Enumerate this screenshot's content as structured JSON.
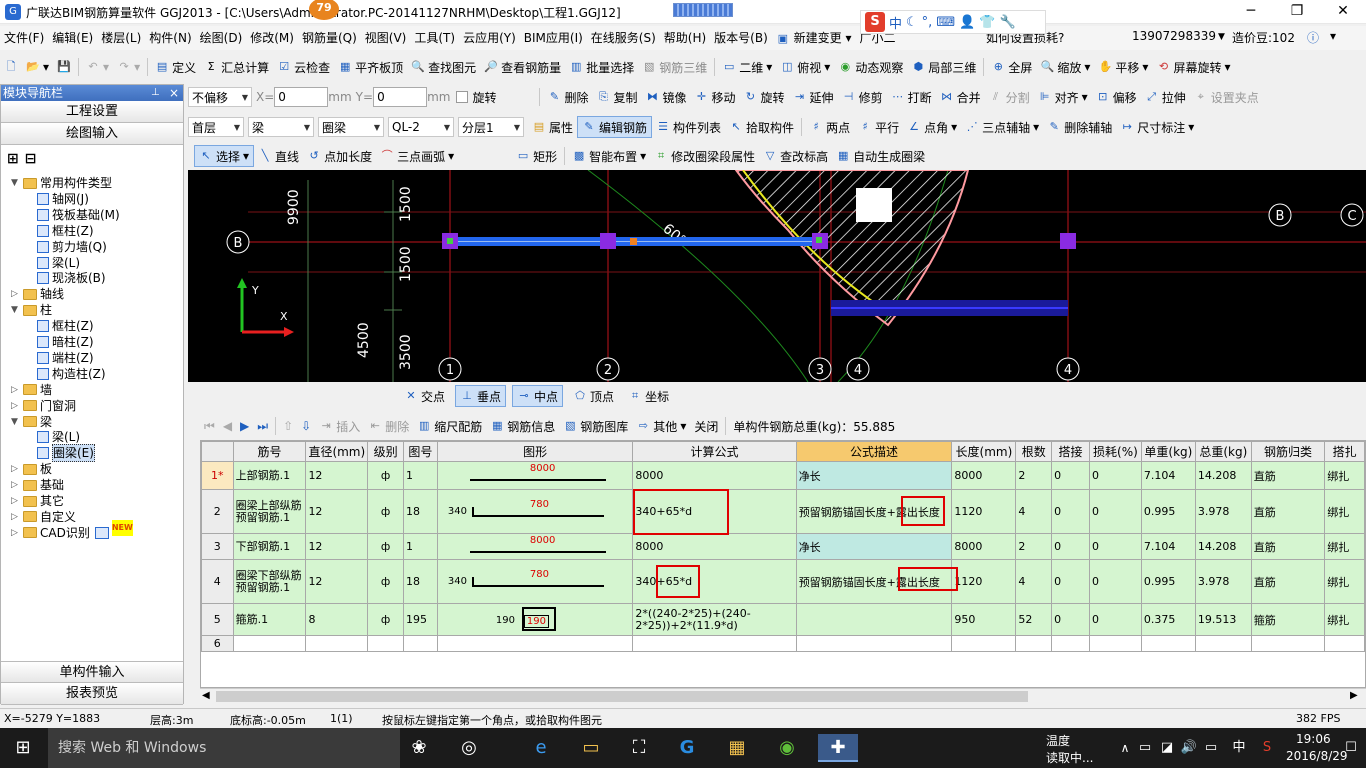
{
  "titlebar": {
    "title": "广联达BIM钢筋算量软件 GGJ2013 - [C:\\Users\\Administrator.PC-20141127NRHM\\Desktop\\工程1.GGJ12]",
    "badge": "79",
    "minimize": "─",
    "restore": "❐",
    "close": "✕"
  },
  "ime": {
    "logo": "S",
    "mode": "中"
  },
  "menubar": {
    "items": [
      "文件(F)",
      "编辑(E)",
      "楼层(L)",
      "构件(N)",
      "绘图(D)",
      "修改(M)",
      "钢筋量(Q)",
      "视图(V)",
      "工具(T)",
      "云应用(Y)",
      "BIM应用(I)",
      "在线服务(S)",
      "帮助(H)",
      "版本号(B)"
    ],
    "new_change": "新建变更",
    "guangxiaoer": "广小二",
    "question": "如何设置损耗?",
    "phone": "13907298339",
    "credits": "造价豆:102"
  },
  "toolbar1": {
    "items": [
      "定义",
      "汇总计算",
      "云检查",
      "平齐板顶",
      "查找图元",
      "查看钢筋量",
      "批量选择",
      "钢筋三维"
    ],
    "view_items": [
      "二维",
      "俯视",
      "动态观察",
      "局部三维",
      "全屏",
      "缩放",
      "平移",
      "屏幕旋转"
    ]
  },
  "toolbar2": {
    "offset_mode": "不偏移",
    "x_label": "X=",
    "x_value": "0",
    "unit_mm": "mm",
    "y_label": "Y=",
    "y_value": "0",
    "rotate": "旋转",
    "items": [
      "删除",
      "复制",
      "镜像",
      "移动",
      "旋转",
      "延伸",
      "修剪",
      "打断",
      "合并",
      "分割",
      "对齐",
      "偏移",
      "拉伸",
      "设置夹点"
    ]
  },
  "toolbar3": {
    "floor": "首层",
    "type": "梁",
    "subtype": "圈梁",
    "name": "QL-2",
    "layer": "分层1",
    "items": [
      "属性",
      "编辑钢筋",
      "构件列表",
      "拾取构件",
      "两点",
      "平行",
      "点角",
      "三点辅轴",
      "删除辅轴",
      "尺寸标注"
    ]
  },
  "toolbar4": {
    "items": [
      "选择",
      "直线",
      "点加长度",
      "三点画弧",
      "矩形",
      "智能布置",
      "修改圈梁段属性",
      "查改标高",
      "自动生成圈梁"
    ]
  },
  "leftpanel": {
    "title": "模块导航栏",
    "pin": "📌",
    "close": "×",
    "tabs": [
      "工程设置",
      "绘图输入"
    ],
    "bottom_tabs": [
      "单构件输入",
      "报表预览"
    ],
    "tree": [
      {
        "label": "常用构件类型",
        "level": 1,
        "kind": "folder",
        "expanded": true
      },
      {
        "label": "轴网(J)",
        "level": 2,
        "kind": "leaf"
      },
      {
        "label": "筏板基础(M)",
        "level": 2,
        "kind": "leaf"
      },
      {
        "label": "框柱(Z)",
        "level": 2,
        "kind": "leaf"
      },
      {
        "label": "剪力墙(Q)",
        "level": 2,
        "kind": "leaf"
      },
      {
        "label": "梁(L)",
        "level": 2,
        "kind": "leaf"
      },
      {
        "label": "现浇板(B)",
        "level": 2,
        "kind": "leaf"
      },
      {
        "label": "轴线",
        "level": 1,
        "kind": "folder",
        "expanded": false
      },
      {
        "label": "柱",
        "level": 1,
        "kind": "folder",
        "expanded": true
      },
      {
        "label": "框柱(Z)",
        "level": 2,
        "kind": "leaf"
      },
      {
        "label": "暗柱(Z)",
        "level": 2,
        "kind": "leaf"
      },
      {
        "label": "端柱(Z)",
        "level": 2,
        "kind": "leaf"
      },
      {
        "label": "构造柱(Z)",
        "level": 2,
        "kind": "leaf"
      },
      {
        "label": "墙",
        "level": 1,
        "kind": "folder",
        "expanded": false
      },
      {
        "label": "门窗洞",
        "level": 1,
        "kind": "folder",
        "expanded": false
      },
      {
        "label": "梁",
        "level": 1,
        "kind": "folder",
        "expanded": true
      },
      {
        "label": "梁(L)",
        "level": 2,
        "kind": "leaf"
      },
      {
        "label": "圈梁(E)",
        "level": 2,
        "kind": "leaf",
        "selected": true
      },
      {
        "label": "板",
        "level": 1,
        "kind": "folder",
        "expanded": false
      },
      {
        "label": "基础",
        "level": 1,
        "kind": "folder",
        "expanded": false
      },
      {
        "label": "其它",
        "level": 1,
        "kind": "folder",
        "expanded": false
      },
      {
        "label": "自定义",
        "level": 1,
        "kind": "folder",
        "expanded": false
      },
      {
        "label": "CAD识别",
        "level": 1,
        "kind": "folder",
        "expanded": false,
        "badge": "NEW"
      }
    ]
  },
  "canvas": {
    "left_labels": [
      "9900",
      "1500",
      "1500",
      "4500",
      "3500"
    ],
    "angle": "60°",
    "axis_left": "B",
    "axis_right": [
      "B",
      "C"
    ],
    "axis_bottom": [
      "1",
      "2",
      "3",
      "4",
      "4"
    ],
    "y_label": "Y",
    "x_label": "X"
  },
  "snapbar": {
    "items": [
      "交点",
      "垂点",
      "中点",
      "顶点",
      "坐标"
    ]
  },
  "gridtb": {
    "items": [
      "插入",
      "删除",
      "缩尺配筋",
      "钢筋信息",
      "钢筋图库",
      "其他",
      "关闭"
    ],
    "total": "单构件钢筋总重(kg)：55.885"
  },
  "table": {
    "headers": [
      "筋号",
      "直径(mm)",
      "级别",
      "图号",
      "图形",
      "计算公式",
      "公式描述",
      "长度(mm)",
      "根数",
      "搭接",
      "损耗(%)",
      "单重(kg)",
      "总重(kg)",
      "钢筋归类",
      "搭扎"
    ],
    "rows": [
      {
        "no": "1*",
        "name": "上部钢筋.1",
        "dia": "12",
        "grade": "ф",
        "fig": "1",
        "shape_left": "",
        "shape_label": "8000",
        "formula": "8000",
        "desc": "净长",
        "len": "8000",
        "count": "2",
        "lap": "0",
        "loss": "0",
        "unit": "7.104",
        "total": "14.208",
        "cat": "直筋",
        "tie": "绑扎"
      },
      {
        "no": "2",
        "name": "圈梁上部纵筋预留钢筋.1",
        "dia": "12",
        "grade": "ф",
        "fig": "18",
        "shape_left": "340",
        "shape_label": "780",
        "formula": "340+65*d",
        "desc": "预留钢筋锚固长度+露出长度",
        "len": "1120",
        "count": "4",
        "lap": "0",
        "loss": "0",
        "unit": "0.995",
        "total": "3.978",
        "cat": "直筋",
        "tie": "绑扎"
      },
      {
        "no": "3",
        "name": "下部钢筋.1",
        "dia": "12",
        "grade": "ф",
        "fig": "1",
        "shape_left": "",
        "shape_label": "8000",
        "formula": "8000",
        "desc": "净长",
        "len": "8000",
        "count": "2",
        "lap": "0",
        "loss": "0",
        "unit": "7.104",
        "total": "14.208",
        "cat": "直筋",
        "tie": "绑扎"
      },
      {
        "no": "4",
        "name": "圈梁下部纵筋预留钢筋.1",
        "dia": "12",
        "grade": "ф",
        "fig": "18",
        "shape_left": "340",
        "shape_label": "780",
        "formula": "340+65*d",
        "desc": "预留钢筋锚固长度+露出长度",
        "len": "1120",
        "count": "4",
        "lap": "0",
        "loss": "0",
        "unit": "0.995",
        "total": "3.978",
        "cat": "直筋",
        "tie": "绑扎"
      },
      {
        "no": "5",
        "name": "箍筋.1",
        "dia": "8",
        "grade": "ф",
        "fig": "195",
        "shape_left": "190",
        "shape_label": "190",
        "formula": "2*((240-2*25)+(240-2*25))+2*(11.9*d)",
        "desc": "",
        "len": "950",
        "count": "52",
        "lap": "0",
        "loss": "0",
        "unit": "0.375",
        "total": "19.513",
        "cat": "箍筋",
        "tie": "绑扎"
      },
      {
        "no": "6",
        "name": "",
        "dia": "",
        "grade": "",
        "fig": "",
        "shape_left": "",
        "shape_label": "",
        "formula": "",
        "desc": "",
        "len": "",
        "count": "",
        "lap": "",
        "loss": "",
        "unit": "",
        "total": "",
        "cat": "",
        "tie": ""
      }
    ]
  },
  "statusbar": {
    "coords": "X=-5279 Y=1883",
    "floor_height": "层高:3m",
    "base_elev": "底标高:-0.05m",
    "count": "1(1)",
    "hint": "按鼠标左键指定第一个角点，或拾取构件图元",
    "fps": "382 FPS"
  },
  "taskbar": {
    "search": "搜索 Web 和 Windows",
    "weather_line1": "温度",
    "weather_line2": "读取中...",
    "ime": "中",
    "time": "19:06",
    "date": "2016/8/29"
  }
}
